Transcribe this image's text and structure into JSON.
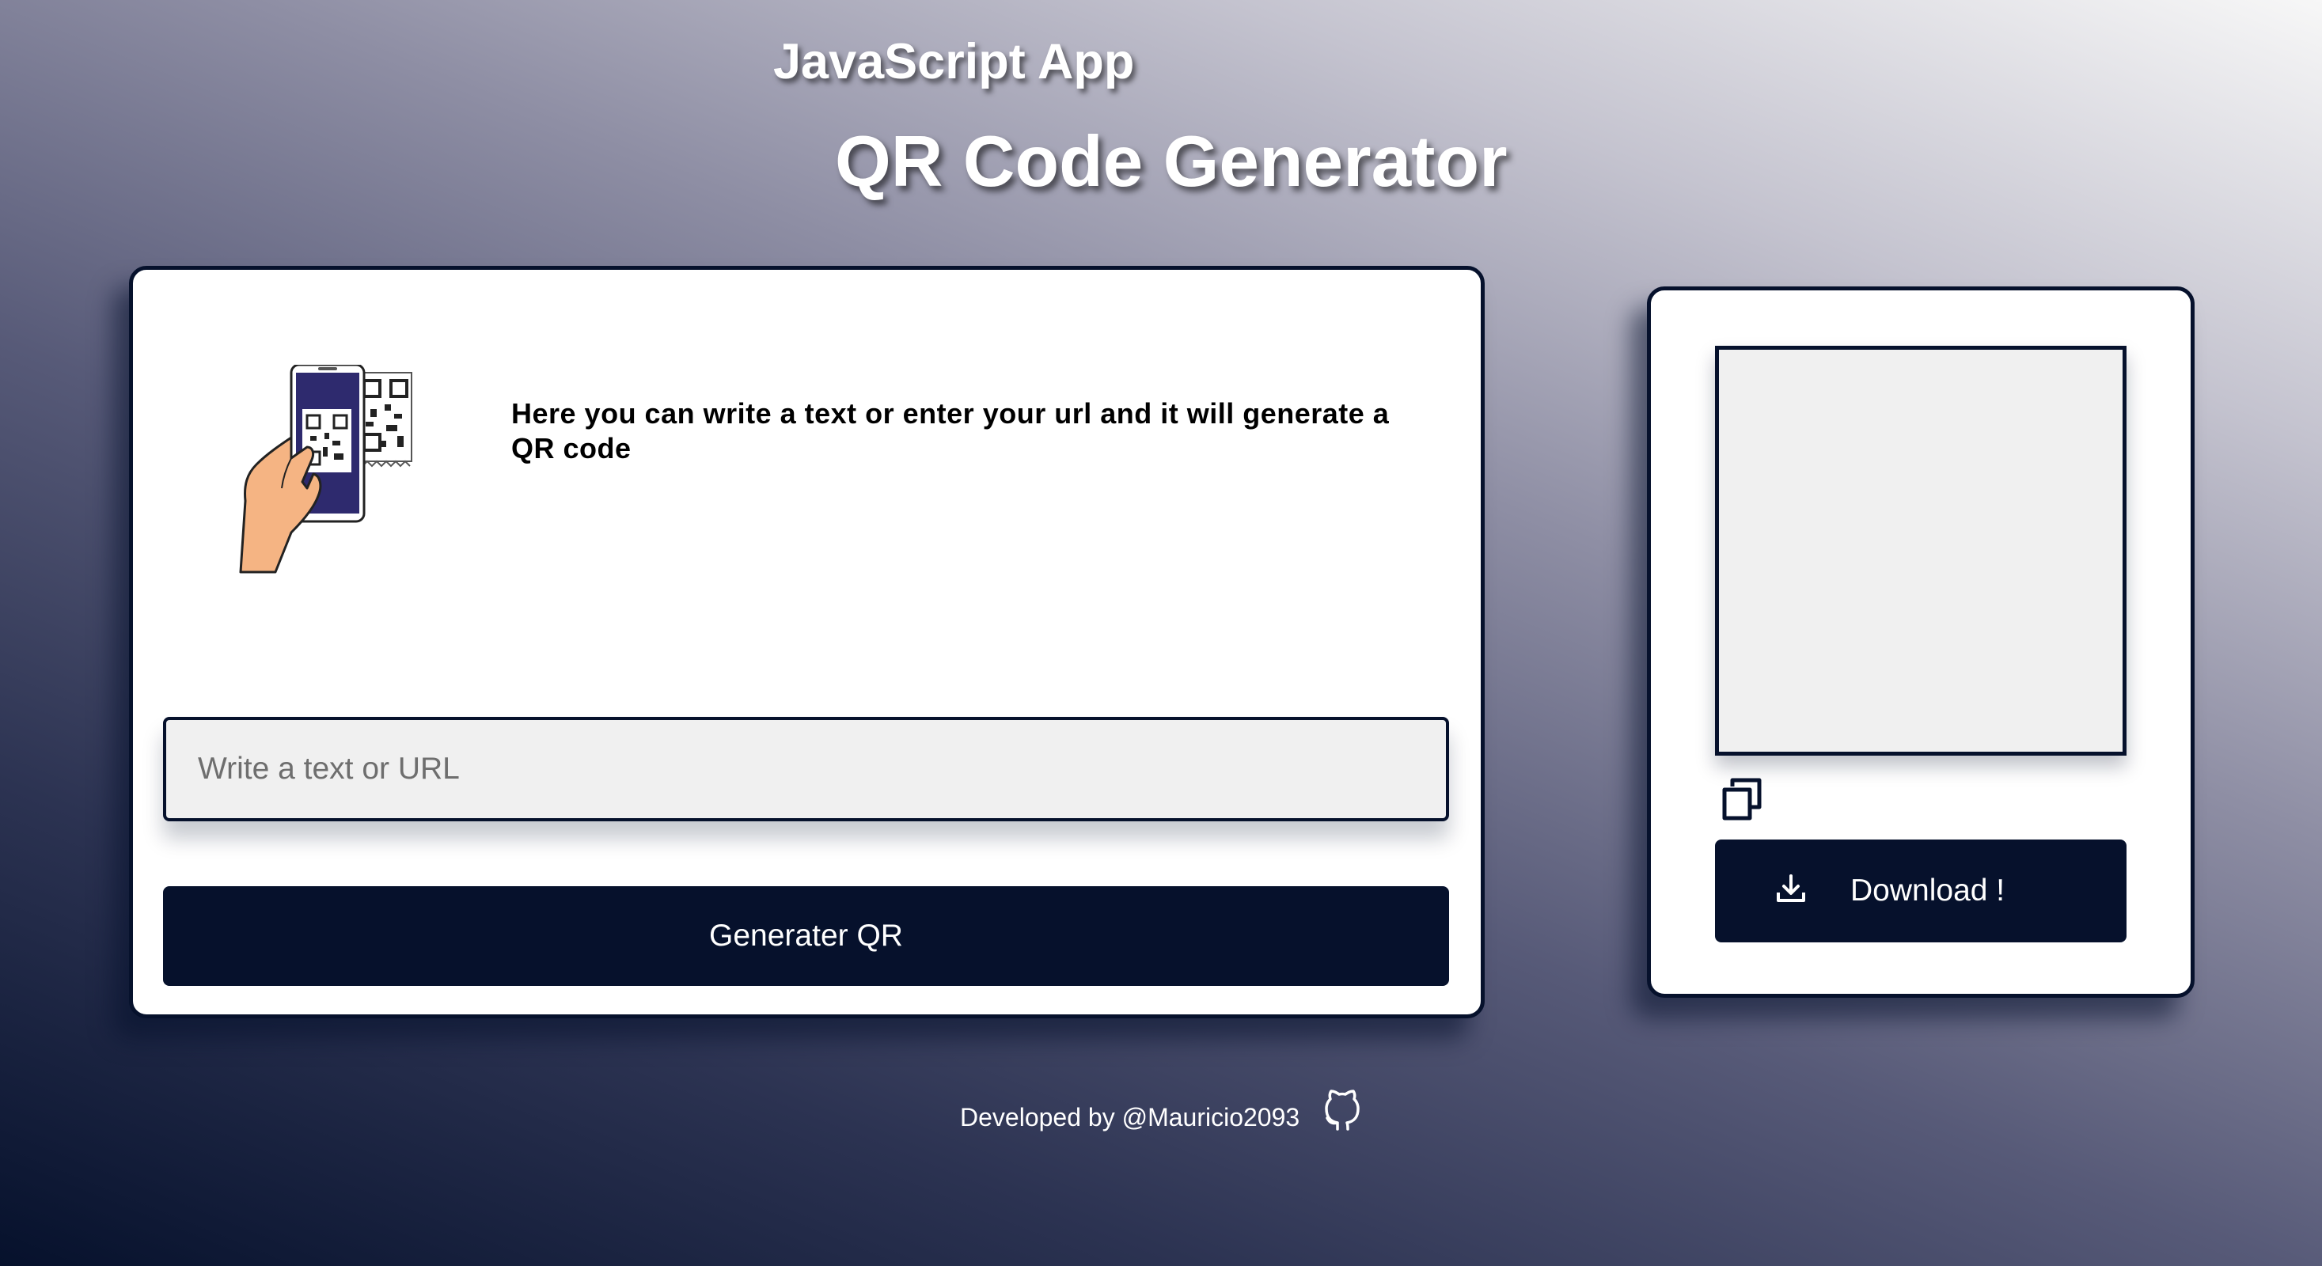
{
  "header": {
    "subtitle": "JavaScript App",
    "title": "QR Code Generator"
  },
  "generator": {
    "illustration": "hand-phone-scanning-qr-illustration",
    "info_text": "Here you can write a text or enter your url and it will generate a QR code",
    "input": {
      "placeholder": "Write a text or URL",
      "value": ""
    },
    "generate_label": "Generater QR"
  },
  "output": {
    "copy_icon": "copy-icon",
    "download_icon": "download-icon",
    "download_label": "Download !"
  },
  "footer": {
    "credit": "Developed by @Mauricio2093",
    "github_icon": "github-icon"
  },
  "colors": {
    "navy": "#06112c",
    "input_bg": "#f0f0f0",
    "card_bg": "#ffffff",
    "phone_screen": "#2e2a6e",
    "skin": "#f5b483"
  }
}
